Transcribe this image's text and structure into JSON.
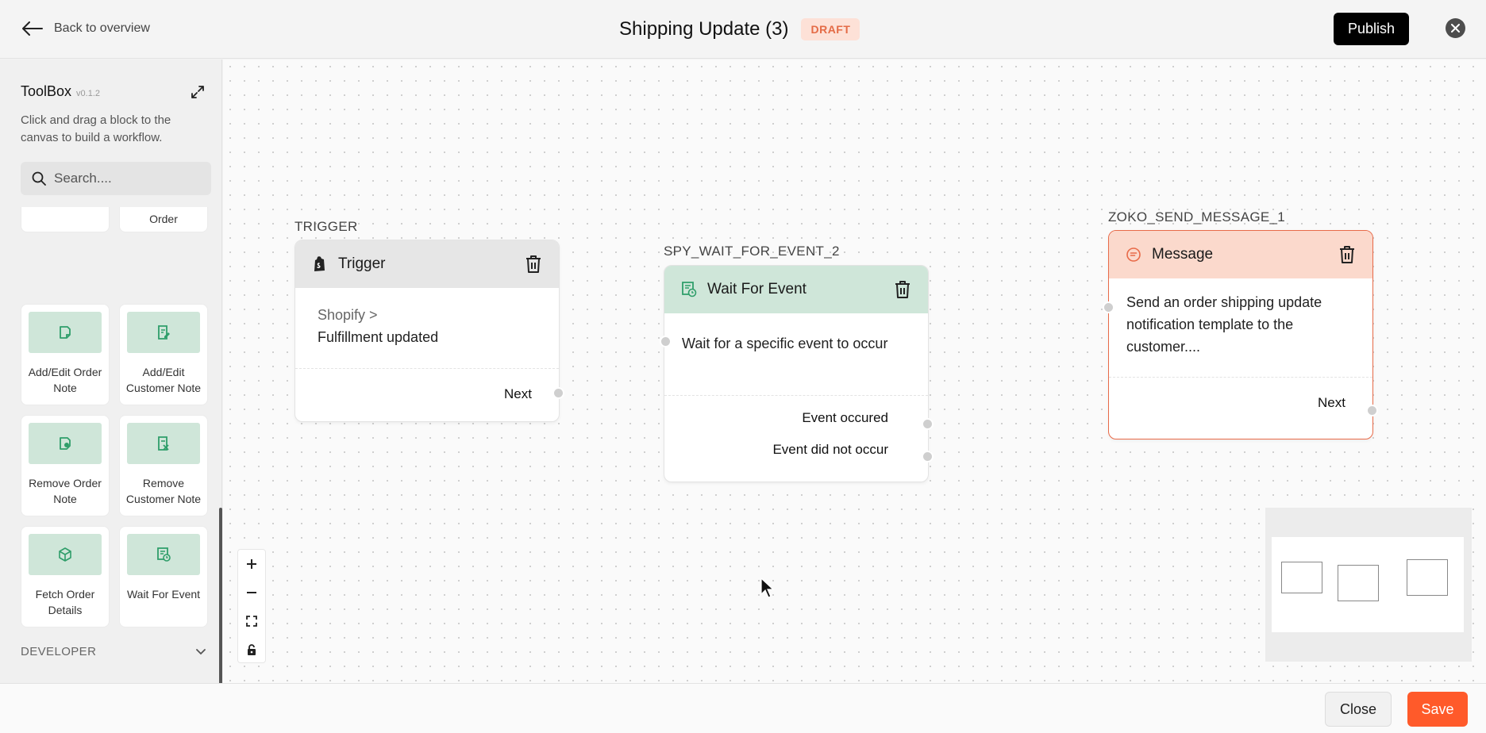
{
  "header": {
    "back_label": "Back to overview",
    "title": "Shipping Update (3)",
    "status_badge": "DRAFT",
    "publish_label": "Publish"
  },
  "toolbox": {
    "title": "ToolBox",
    "version": "v0.1.2",
    "description": "Click and drag a block to the canvas to build a workflow.",
    "search_placeholder": "Search....",
    "blocks": [
      {
        "label": "",
        "icon": "partially-visible-block"
      },
      {
        "label": "Order",
        "icon": "partially-visible-block"
      },
      {
        "label": "Add/Edit Order Note",
        "icon": "note-add-icon"
      },
      {
        "label": "Add/Edit Customer Note",
        "icon": "note-edit-icon"
      },
      {
        "label": "Remove Order Note",
        "icon": "note-remove-icon"
      },
      {
        "label": "Remove Customer Note",
        "icon": "customer-note-remove-icon"
      },
      {
        "label": "Fetch Order Details",
        "icon": "box-icon"
      },
      {
        "label": "Wait For Event",
        "icon": "wait-event-icon"
      }
    ],
    "developer_section": "DEVELOPER"
  },
  "canvas": {
    "nodes": {
      "trigger": {
        "label": "TRIGGER",
        "title": "Trigger",
        "icon": "shopify-icon",
        "source": "Shopify >",
        "event": "Fulfillment updated",
        "outputs": [
          "Next"
        ]
      },
      "wait": {
        "label": "SPY_WAIT_FOR_EVENT_2",
        "title": "Wait For Event",
        "icon": "wait-event-icon",
        "description": "Wait for a specific event to occur",
        "outputs": [
          "Event occured",
          "Event did not occur"
        ]
      },
      "message": {
        "label": "ZOKO_SEND_MESSAGE_1",
        "title": "Message",
        "icon": "message-icon",
        "description": "Send an order shipping update notification template to the customer....",
        "outputs": [
          "Next"
        ]
      }
    }
  },
  "footer": {
    "close_label": "Close",
    "save_label": "Save"
  },
  "colors": {
    "accent": "#ff5a2a",
    "draft_badge_text": "#e46b46",
    "draft_badge_bg": "#fde1d7",
    "trigger_header": "#e6e6e6",
    "wait_header": "#cfe6d9",
    "message_header": "#fbd9cc",
    "message_border": "#e86a48",
    "toolbox_icon_bg": "#cfe6d9"
  }
}
